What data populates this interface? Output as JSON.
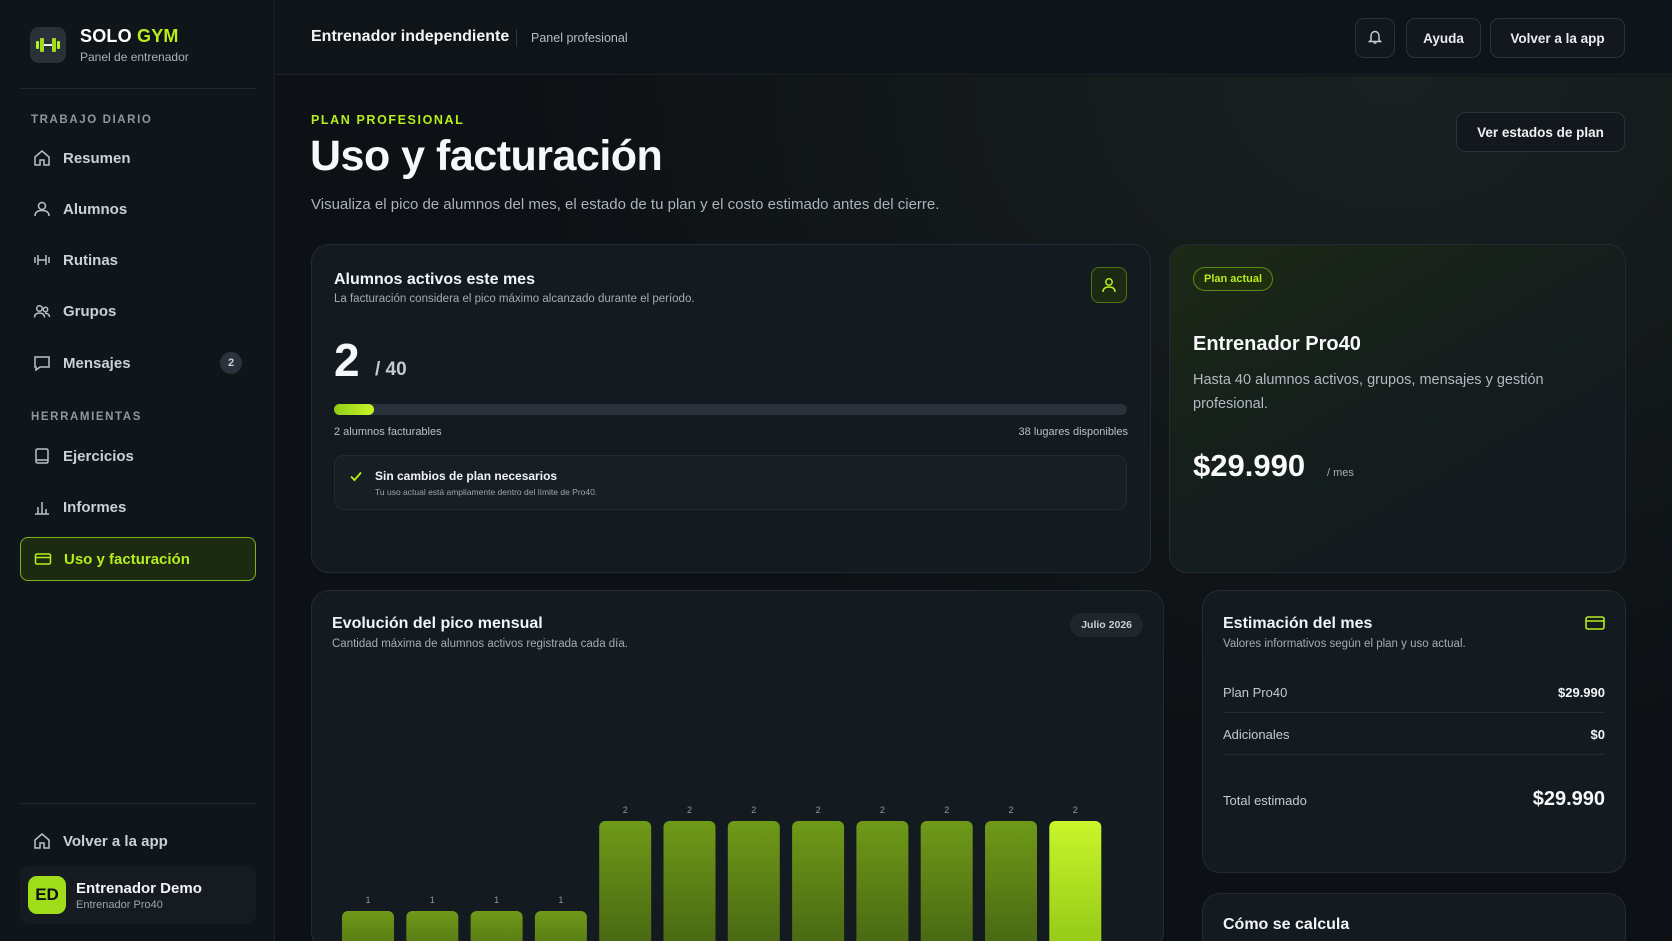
{
  "brand": {
    "name_main": "SOLO",
    "name_accent": "GYM",
    "subtitle": "Panel de entrenador"
  },
  "sidebar": {
    "section_daily": "TRABAJO DIARIO",
    "section_tools": "HERRAMIENTAS",
    "items": [
      {
        "label": "Resumen",
        "icon": "home-icon"
      },
      {
        "label": "Alumnos",
        "icon": "user-icon"
      },
      {
        "label": "Rutinas",
        "icon": "dumbbell-icon"
      },
      {
        "label": "Grupos",
        "icon": "users-icon"
      },
      {
        "label": "Mensajes",
        "icon": "message-icon",
        "badge": "2"
      },
      {
        "label": "Ejercicios",
        "icon": "book-icon"
      },
      {
        "label": "Informes",
        "icon": "bar-chart-icon"
      },
      {
        "label": "Uso y facturación",
        "icon": "card-icon",
        "active": true
      }
    ],
    "back_to_app": "Volver a la app",
    "user": {
      "initials": "ED",
      "name": "Entrenador Demo",
      "plan": "Entrenador Pro40"
    }
  },
  "topbar": {
    "title": "Entrenador independiente",
    "subtitle": "Panel profesional",
    "help": "Ayuda",
    "back": "Volver a la app"
  },
  "page": {
    "eyebrow": "PLAN PROFESIONAL",
    "title": "Uso y facturación",
    "description": "Visualiza el pico de alumnos del mes, el estado de tu plan y el costo estimado antes del cierre.",
    "plan_states_button": "Ver estados de plan"
  },
  "active_students": {
    "title": "Alumnos activos este mes",
    "subtitle": "La facturación considera el pico máximo alcanzado durante el período.",
    "count": "2",
    "max": "/ 40",
    "progress_fraction": 0.05,
    "billable": "2 alumnos facturables",
    "available": "38 lugares disponibles",
    "notice_title": "Sin cambios de plan necesarios",
    "notice_sub": "Tu uso actual está ampliamente dentro del límite de Pro40."
  },
  "plan": {
    "pill": "Plan actual",
    "name": "Entrenador Pro40",
    "description": "Hasta 40 alumnos activos, grupos, mensajes y gestión profesional.",
    "price": "$29.990",
    "period": "/ mes"
  },
  "chart": {
    "title": "Evolución del pico mensual",
    "subtitle": "Cantidad máxima de alumnos activos registrada cada día.",
    "month": "Julio 2026"
  },
  "chart_data": {
    "type": "bar",
    "values": [
      1,
      1,
      1,
      1,
      2,
      2,
      2,
      2,
      2,
      2,
      2,
      2
    ],
    "highlight_last": true,
    "colors": {
      "bar": "#6f9a18",
      "highlight": "#b6ee1f"
    }
  },
  "estimate": {
    "title": "Estimación del mes",
    "subtitle": "Valores informativos según el plan y uso actual.",
    "rows": [
      {
        "label": "Plan Pro40",
        "value": "$29.990"
      },
      {
        "label": "Adicionales",
        "value": "$0"
      }
    ],
    "total_label": "Total estimado",
    "total_value": "$29.990"
  },
  "calc": {
    "title": "Cómo se calcula"
  },
  "colors": {
    "accent": "#b6ee1f",
    "background": "#0d1115",
    "card": "#131a20"
  }
}
